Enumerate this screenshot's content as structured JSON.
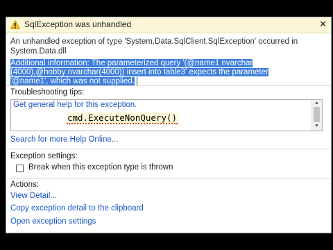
{
  "dialog": {
    "title": "SqlException was unhandled",
    "description": "An unhandled exception of type 'System.Data.SqlClient.SqlException' occurred in System.Data.dll",
    "additional_lines": [
      "Additional information: The parameterized query '(@name1 nvarchar",
      "(4000),@hobby nvarchar(4000)) insert into table3' expects the parameter",
      "'@name1', which was not supplied."
    ],
    "close_glyph": "✕"
  },
  "troubleshooting": {
    "heading": "Troubleshooting tips:",
    "tip_link": "Get general help for this exception.",
    "code_snippet": "cmd.ExecuteNonQuery()",
    "search_link": "Search for more Help Online..."
  },
  "exception_settings": {
    "heading": "Exception settings:",
    "checkbox_label": "Break when this exception type is thrown",
    "checked": false
  },
  "actions": {
    "heading": "Actions:",
    "items": [
      "View Detail...",
      "Copy exception detail to the clipboard",
      "Open exception settings"
    ]
  },
  "colors": {
    "titlebar_bg": "#fdf6d8",
    "selection": "#3f7fdc",
    "link": "#1a56c8"
  }
}
